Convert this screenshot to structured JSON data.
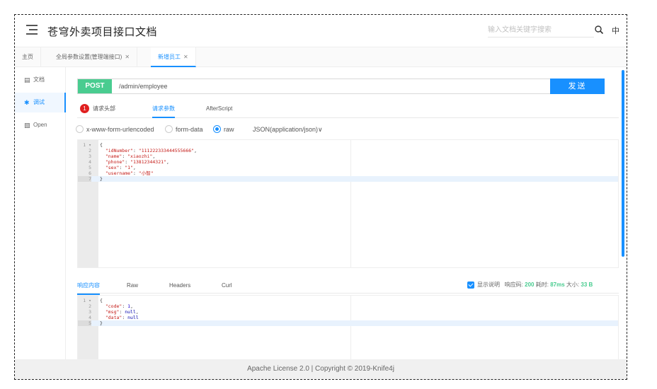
{
  "header": {
    "title": "苍穹外卖项目接口文档",
    "search_placeholder": "输入文档关键字搜索",
    "lang": "中"
  },
  "tabs": [
    {
      "label": "主页",
      "closable": false
    },
    {
      "label": "全局参数设置(管理端接口)",
      "closable": true
    },
    {
      "label": "新增员工",
      "closable": true,
      "active": true
    }
  ],
  "sidebar": {
    "items": [
      {
        "icon": "doc-icon",
        "label": "文档"
      },
      {
        "icon": "debug-icon",
        "label": "调试",
        "active": true
      },
      {
        "icon": "open-icon",
        "label": "Open"
      }
    ]
  },
  "request": {
    "method": "POST",
    "url": "/admin/employee",
    "send_label": "发送",
    "tabs": {
      "headers": "请求头部",
      "headers_badge": "1",
      "params": "请求参数",
      "afterscript": "AfterScript"
    },
    "body_types": {
      "urlencoded": "x-www-form-urlencoded",
      "formdata": "form-data",
      "raw": "raw",
      "json": "JSON(application/json)"
    },
    "body_lines": [
      {
        "n": "1",
        "fold": "▾",
        "text": "{"
      },
      {
        "n": "2",
        "key": "\"idNumber\"",
        "val": "\"111222333444555666\"",
        "tail": ","
      },
      {
        "n": "3",
        "key": "\"name\"",
        "val": "\"xiaozhi\"",
        "tail": ","
      },
      {
        "n": "4",
        "key": "\"phone\"",
        "val": "\"13812344321\"",
        "tail": ","
      },
      {
        "n": "5",
        "key": "\"sex\"",
        "val": "\"1\"",
        "tail": ","
      },
      {
        "n": "6",
        "key": "\"username\"",
        "val": "\"小智\"",
        "tail": ""
      },
      {
        "n": "7",
        "text": "}"
      }
    ]
  },
  "response": {
    "tabs": {
      "content": "响应内容",
      "raw": "Raw",
      "headers": "Headers",
      "curl": "Curl"
    },
    "show_desc_label": "显示说明",
    "code_label": "响应码:",
    "code_value": "200",
    "time_label": "耗时:",
    "time_value": "87ms",
    "size_label": "大小:",
    "size_value": "33 B",
    "body_lines": [
      {
        "n": "1",
        "fold": "▾",
        "text": "{"
      },
      {
        "n": "2",
        "key": "\"code\"",
        "num": "1",
        "tail": ","
      },
      {
        "n": "3",
        "key": "\"msg\"",
        "kw": "null",
        "tail": ","
      },
      {
        "n": "4",
        "key": "\"data\"",
        "kw": "null",
        "tail": ""
      },
      {
        "n": "5",
        "text": "}"
      }
    ]
  },
  "footer": {
    "text": "Apache License 2.0 | Copyright © 2019-Knife4j"
  },
  "colors": {
    "accent": "#1890ff",
    "post": "#49cc90",
    "badge": "#e02020"
  }
}
